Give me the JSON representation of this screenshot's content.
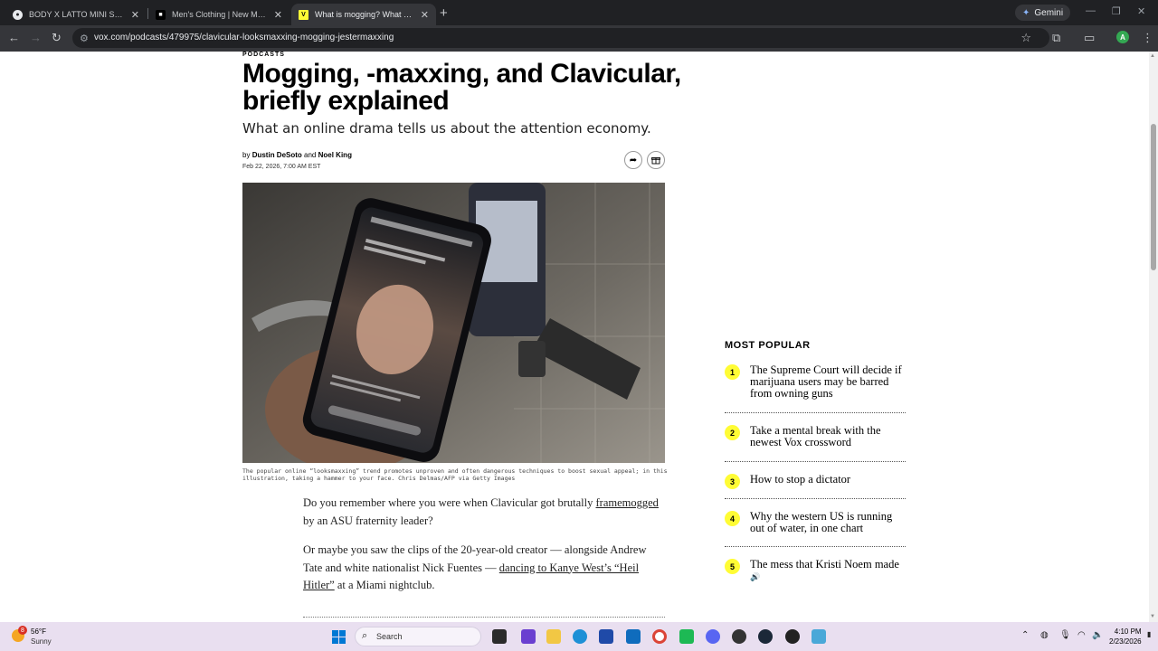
{
  "tabs": [
    {
      "title": "BODY X LATTO MINI SHORTS (B",
      "icon": "github-icon"
    },
    {
      "title": "Men's Clothing | New Men's Cl",
      "icon": "store-icon"
    },
    {
      "title": "What is mogging? What is look",
      "icon": "vox-icon",
      "active": true
    }
  ],
  "browser": {
    "gemini_label": "Gemini",
    "url": "vox.com/podcasts/479975/clavicular-looksmaxxing-mogging-jestermaxxing",
    "profile_initial": "A"
  },
  "article": {
    "section": "PODCASTS",
    "headline": "Mogging, -maxxing, and Clavicular, briefly explained",
    "dek": "What an online drama tells us about the attention economy.",
    "by": "by",
    "author1": "Dustin DeSoto",
    "and": "and",
    "author2": "Noel King",
    "date": "Feb 22, 2026, 7:00 AM EST",
    "caption": "The popular online “looksmaxxing” trend promotes unproven and often dangerous techniques to boost sexual appeal; in this illustration, taking a hammer to your face. Chris Delmas/AFP via Getty Images",
    "p1_a": "Do you remember where you were when Clavicular got brutally",
    "p1_link": "framemogged",
    "p1_b": " by an ASU fraternity leader?",
    "p2_a": "Or maybe you saw the clips of the 20-year-old creator — alongside Andrew Tate and white nationalist Nick Fuentes — ",
    "p2_link": "dancing to Kanye West’s “Heil Hitler”",
    "p2_b": " at a Miami nightclub."
  },
  "most_popular": {
    "title": "MOST POPULAR",
    "items": [
      {
        "num": "1",
        "text": "The Supreme Court will decide if marijuana users may be barred from owning guns"
      },
      {
        "num": "2",
        "text": "Take a mental break with the newest Vox crossword"
      },
      {
        "num": "3",
        "text": "How to stop a dictator"
      },
      {
        "num": "4",
        "text": "Why the western US is running out of water, in one chart"
      },
      {
        "num": "5",
        "text": "The mess that Kristi Noem made"
      }
    ]
  },
  "taskbar": {
    "weather_badge": "8",
    "temp": "56°F",
    "condition": "Sunny",
    "search_label": "Search",
    "time": "4:10 PM",
    "date": "2/23/2026"
  },
  "colors": {
    "highlight": "#fffc35",
    "chrome_dark": "#202124",
    "chrome_mid": "#35363a"
  }
}
